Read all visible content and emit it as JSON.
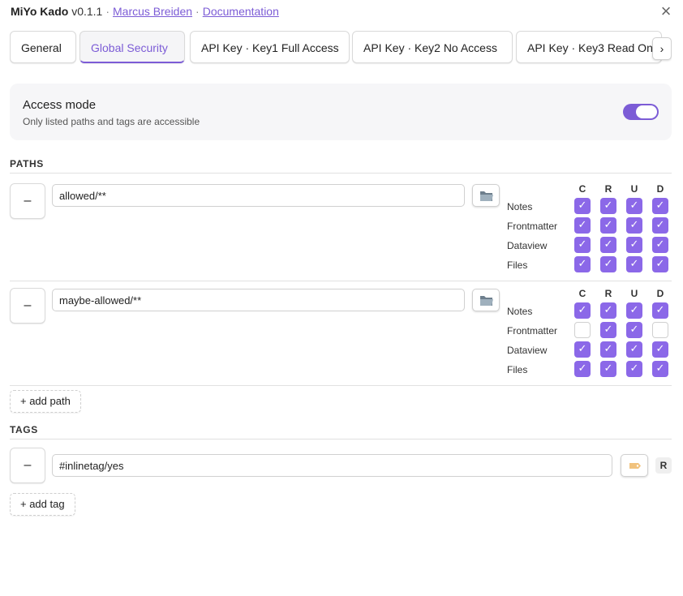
{
  "header": {
    "app_name": "MiYo Kado",
    "version": "v0.1.1",
    "separator": "·",
    "author_link": "Marcus Breiden",
    "docs_link": "Documentation"
  },
  "tabs": [
    {
      "label": "General"
    },
    {
      "label": "Global Security",
      "active": true
    },
    {
      "label": "API Key · Key1 Full Access"
    },
    {
      "label": "API Key · Key2 No Access"
    },
    {
      "label": "API Key · Key3 Read On"
    }
  ],
  "tab_scroll_label": "›",
  "access_mode": {
    "title": "Access mode",
    "description": "Only listed paths and tags are accessible",
    "enabled": true
  },
  "paths_section": {
    "title": "PATHS",
    "columns": [
      "C",
      "R",
      "U",
      "D"
    ],
    "row_labels": [
      "Notes",
      "Frontmatter",
      "Dataview",
      "Files"
    ],
    "rows": [
      {
        "remove_label": "–",
        "value": "allowed/**",
        "permissions": [
          [
            true,
            true,
            true,
            true
          ],
          [
            true,
            true,
            true,
            true
          ],
          [
            true,
            true,
            true,
            true
          ],
          [
            true,
            true,
            true,
            true
          ]
        ]
      },
      {
        "remove_label": "–",
        "value": "maybe-allowed/**",
        "permissions": [
          [
            true,
            true,
            true,
            true
          ],
          [
            false,
            true,
            true,
            false
          ],
          [
            true,
            true,
            true,
            true
          ],
          [
            true,
            true,
            true,
            true
          ]
        ]
      }
    ],
    "add_label": "+ add path"
  },
  "tags_section": {
    "title": "TAGS",
    "rows": [
      {
        "remove_label": "–",
        "value": "#inlinetag/yes",
        "permission": "R"
      }
    ],
    "add_label": "+ add tag"
  },
  "colors": {
    "accent": "#7c5cd6",
    "checkbox": "#8b68e8"
  }
}
